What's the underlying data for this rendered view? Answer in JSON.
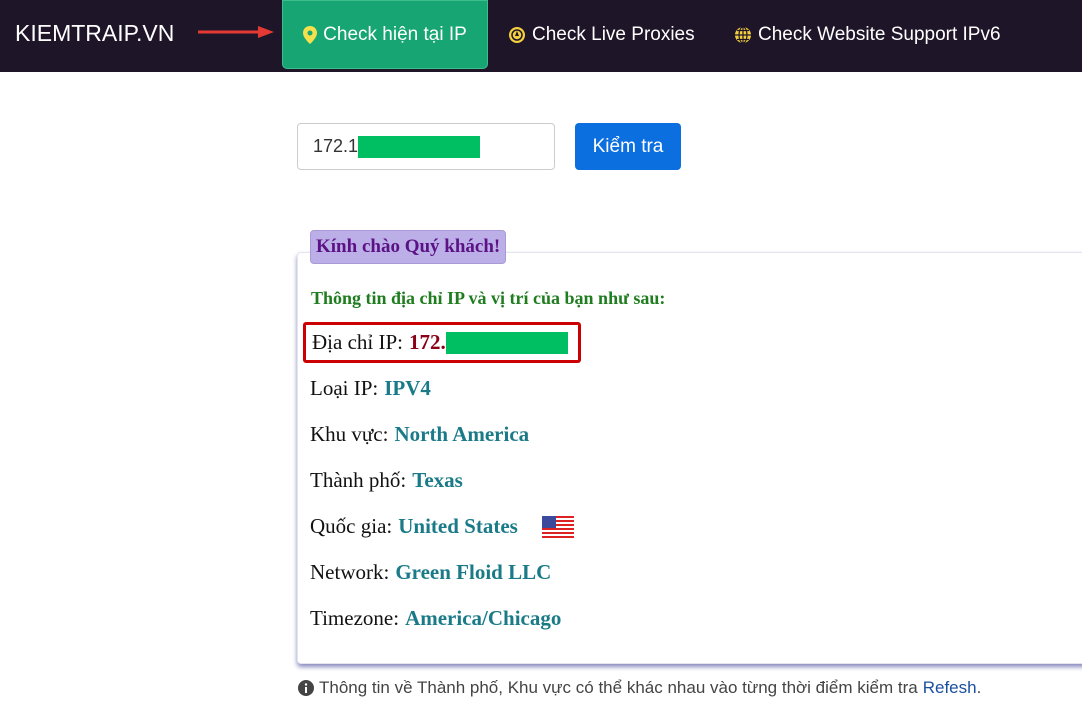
{
  "nav": {
    "brand": "KIEMTRAIP.VN",
    "tabs": [
      {
        "label": "Check hiện tại IP",
        "icon": "map-pin-icon",
        "active": true
      },
      {
        "label": "Check Live Proxies",
        "icon": "compass-icon"
      },
      {
        "label": "Check Website Support IPv6",
        "icon": "globe-icon"
      }
    ]
  },
  "form": {
    "ip_value": "172.1",
    "check_label": "Kiểm tra"
  },
  "card": {
    "greeting": "Kính chào Quý khách!",
    "subtitle": "Thông tin địa chỉ IP và vị trí của bạn như sau:",
    "rows": [
      {
        "label": "Địa chỉ IP:",
        "value": "172."
      },
      {
        "label": "Loại IP:",
        "value": "IPV4"
      },
      {
        "label": "Khu vực:",
        "value": "North America"
      },
      {
        "label": "Thành phố:",
        "value": "Texas"
      },
      {
        "label": "Quốc gia:",
        "value": "United States"
      },
      {
        "label": "Network:",
        "value": "Green Floid LLC"
      },
      {
        "label": "Timezone:",
        "value": "America/Chicago"
      }
    ]
  },
  "footer": {
    "note": "Thông tin về Thành phố, Khu vực có thể khác nhau vào từng thời điểm kiểm tra",
    "link": "Refesh",
    "end": "."
  },
  "colors": {
    "nav": "#1e1528",
    "active_tab": "#17a673",
    "button": "#0b6fe0",
    "mask": "#00bf63",
    "highlight": "#cc0000"
  }
}
